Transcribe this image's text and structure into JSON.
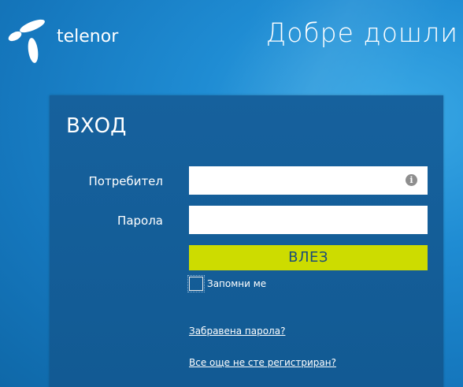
{
  "header": {
    "logo_text": "telenor",
    "welcome": "Добре дошли"
  },
  "login": {
    "title": "ВХОД",
    "username_label": "Потребител",
    "username_value": "",
    "password_label": "Парола",
    "password_value": "",
    "submit_label": "ВЛЕЗ",
    "remember_label": "Запомни ме",
    "remember_checked": false,
    "forgot_link": "Забравена парола?",
    "register_link": "Все още не сте регистриран?"
  },
  "colors": {
    "background": "#1f8cd3",
    "panel": "#16619d",
    "button": "#cddc00",
    "button_text": "#1b4d78"
  }
}
